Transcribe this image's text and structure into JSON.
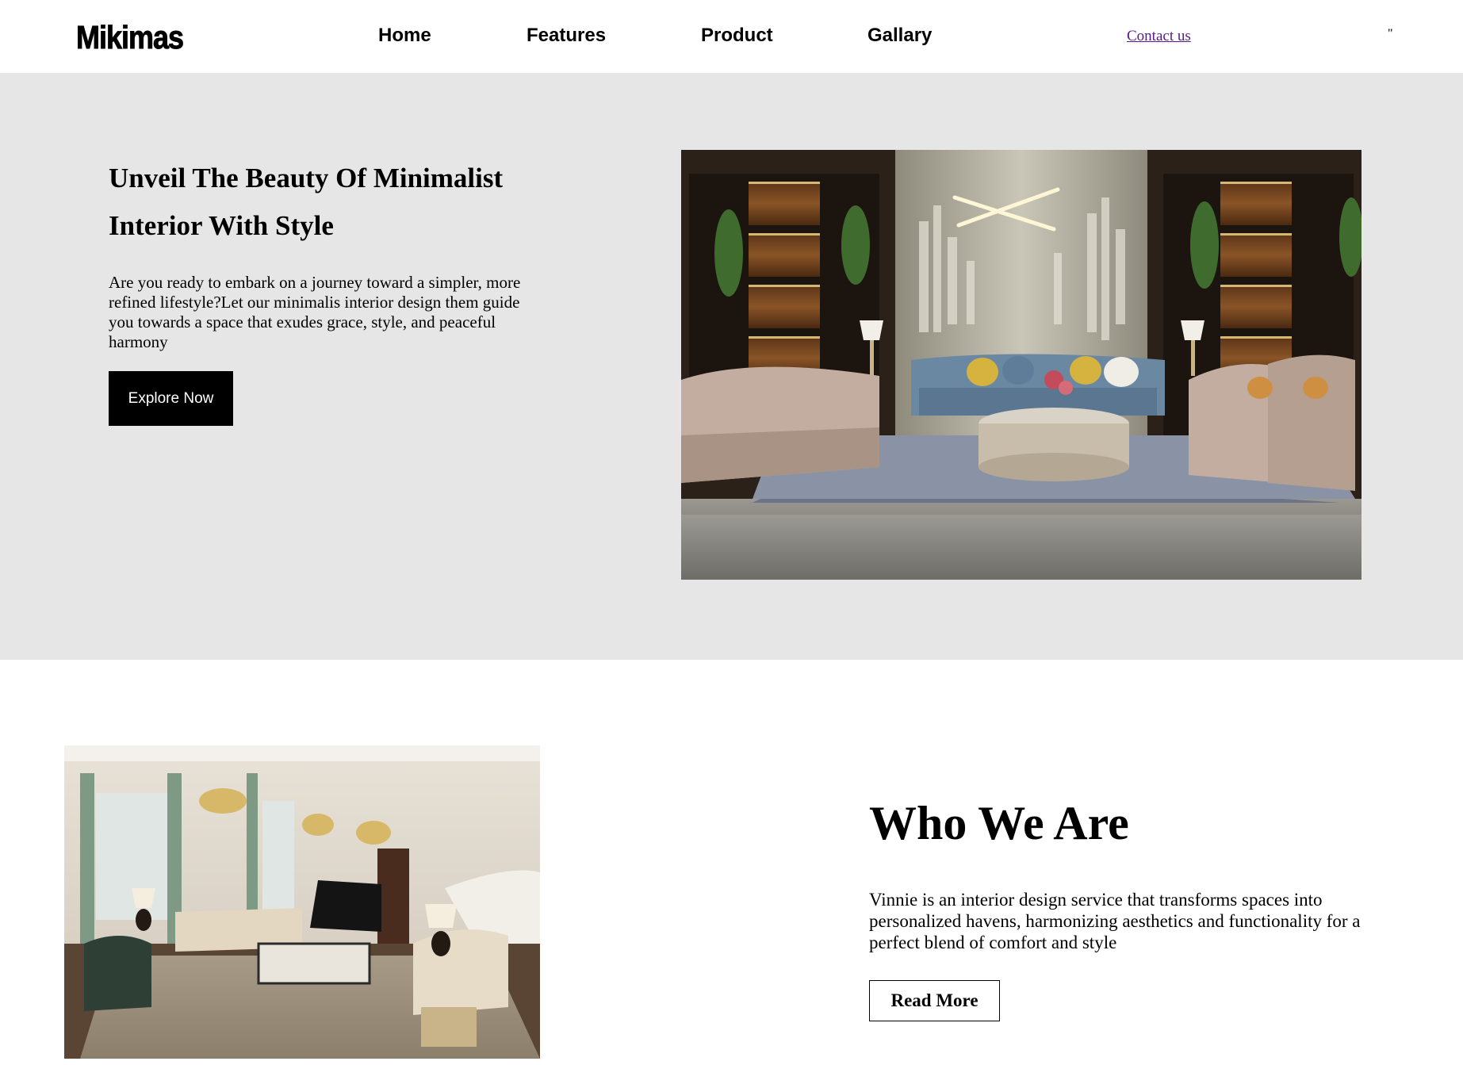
{
  "nav": {
    "logo": "Mikimas",
    "links": [
      "Home",
      "Features",
      "Product",
      "Gallary"
    ],
    "contact": "Contact us",
    "extra": "\""
  },
  "hero": {
    "title_line1": "Unveil The Beauty Of Minimalist",
    "title_line2": "Interior With Style",
    "text": "Are you ready to embark on a journey toward a simpler, more refined lifestyle?Let our minimalis interior design them guide you towards a space that exudes grace, style, and peaceful harmony",
    "button": "Explore Now"
  },
  "about": {
    "title": "Who We Are",
    "text": "Vinnie is an interior design service that transforms spaces into personalized havens, harmonizing aesthetics and functionality for a perfect blend of comfort and style",
    "button": "Read More"
  },
  "colors": {
    "hero_bg": "#e6e6e6",
    "link_visited": "#551a8b",
    "button_bg": "#000000"
  }
}
